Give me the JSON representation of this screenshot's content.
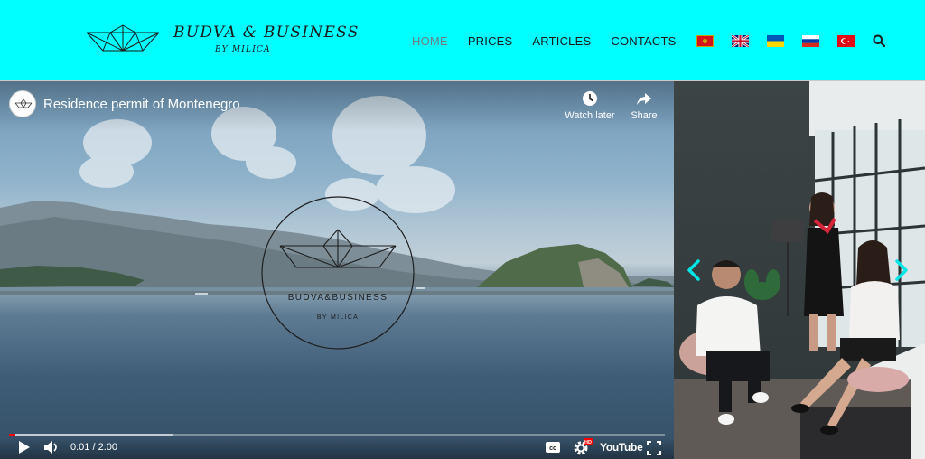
{
  "brand": {
    "title": "BUDVA & BUSINESS",
    "subtitle": "BY MILICA"
  },
  "nav": {
    "items": [
      {
        "label": "HOME",
        "active": true
      },
      {
        "label": "PRICES",
        "active": false
      },
      {
        "label": "ARTICLES",
        "active": false
      },
      {
        "label": "CONTACTS",
        "active": false
      }
    ],
    "languages": [
      "flag-montenegro-icon",
      "flag-uk-icon",
      "flag-ukraine-icon",
      "flag-russia-icon",
      "flag-turkey-icon"
    ]
  },
  "video": {
    "title": "Residence permit of Montenegro",
    "watch_later": "Watch later",
    "share": "Share",
    "logo_title": "BUDVA&BUSINESS",
    "logo_subtitle": "BY MILICA",
    "time": "0:01 / 2:00",
    "played_fraction": 0.01,
    "buffered_fraction": 0.25,
    "youtube_label": "YouTube",
    "hd_badge": "HD"
  },
  "colors": {
    "header_bg": "#00ffff",
    "accent_arrow": "#00e5e5",
    "progress_red": "#ff0000"
  }
}
